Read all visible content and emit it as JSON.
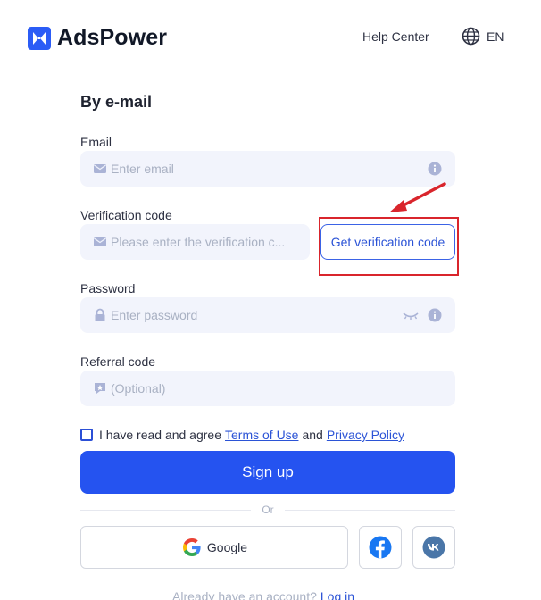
{
  "header": {
    "brand": "AdsPower",
    "help_center": "Help Center",
    "language": "EN"
  },
  "form": {
    "method_title": "By e-mail",
    "email": {
      "label": "Email",
      "placeholder": "Enter email"
    },
    "verification": {
      "label": "Verification code",
      "placeholder": "Please enter the verification c...",
      "button": "Get verification code"
    },
    "password": {
      "label": "Password",
      "placeholder": "Enter password"
    },
    "referral": {
      "label": "Referral code",
      "placeholder": "(Optional)"
    },
    "agree": {
      "prefix": "I have read and agree",
      "terms": "Terms of Use",
      "and": "and",
      "privacy": "Privacy Policy"
    },
    "signup_label": "Sign up",
    "or_label": "Or",
    "google_label": "Google",
    "footer": {
      "question": "Already have an account?",
      "login": "Log in"
    }
  },
  "icons": [
    "logo-icon",
    "globe-icon",
    "mail-icon",
    "info-icon",
    "lock-icon",
    "eye-closed-icon",
    "referral-icon",
    "google-icon",
    "facebook-icon",
    "vk-icon",
    "arrow-annotation"
  ],
  "colors": {
    "primary": "#2553f0",
    "field_bg": "#f2f4fc",
    "annotation": "#d9252c"
  }
}
